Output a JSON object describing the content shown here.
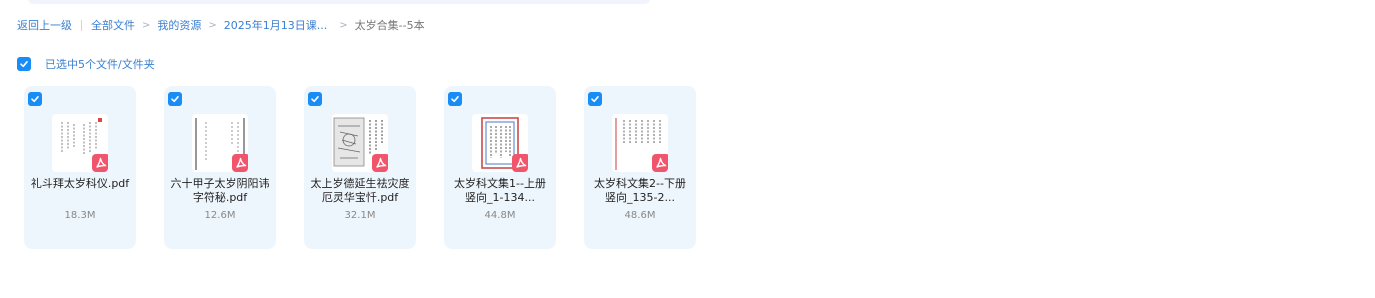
{
  "breadcrumb": {
    "back_label": "返回上一级",
    "items": [
      "全部文件",
      "我的资源",
      "2025年1月13日课..."
    ],
    "current": "太岁合集--5本"
  },
  "selection": {
    "label": "已选中5个文件/文件夹"
  },
  "files": [
    {
      "name": "礼斗拜太岁科仪.pdf",
      "size": "18.3M"
    },
    {
      "name": "六十甲子太岁阴阳讳字符秘.pdf",
      "size": "12.6M"
    },
    {
      "name": "太上岁德延生祛灾度厄灵华宝忏.pdf",
      "size": "32.1M"
    },
    {
      "name": "太岁科文集1--上册竖向_1-134...",
      "size": "44.8M"
    },
    {
      "name": "太岁科文集2--下册竖向_135-2...",
      "size": "48.6M"
    }
  ],
  "colors": {
    "accent": "#1a8cf5",
    "link": "#3a7fd0",
    "card_bg": "#eef6fd",
    "pdf_badge": "#f0556b"
  },
  "icons": {
    "checkbox": "checkbox-checked-icon",
    "pdf": "pdf-icon"
  }
}
